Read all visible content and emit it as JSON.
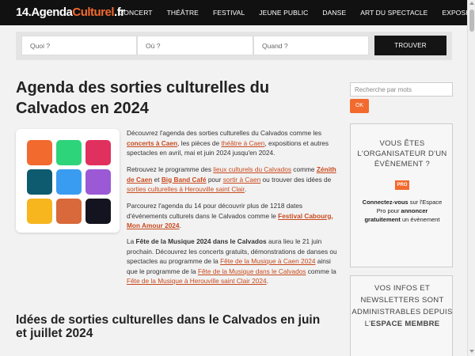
{
  "site": {
    "logo_prefix": "14.Agenda",
    "logo_accent": "Culturel",
    "logo_suffix": ".fr"
  },
  "nav": [
    {
      "label": "CONCERT"
    },
    {
      "label": "THÉÂTRE"
    },
    {
      "label": "FESTIVAL"
    },
    {
      "label": "JEUNE PUBLIC"
    },
    {
      "label": "DANSE"
    },
    {
      "label": "ART DU SPECTACLE"
    },
    {
      "label": "EXPOSITION"
    }
  ],
  "search": {
    "what_placeholder": "Quoi ?",
    "where_placeholder": "Où ?",
    "when_placeholder": "Quand ?",
    "button": "TROUVER"
  },
  "main": {
    "title": "Agenda des sorties culturelles du Calvados en 2024",
    "p1": {
      "a": "Découvrez l'agenda des sorties culturelles du Calvados comme les ",
      "l1": "concerts à Caen",
      "b": ", les pièces de ",
      "l2": "théâtre à Caen",
      "c": ", expositions et autres spectacles en avril, mai et juin 2024 jusqu'en 2024."
    },
    "p2": {
      "a": "Retrouvez le programme des ",
      "l1": "lieux culturels du Calvados",
      "b": " comme ",
      "l2": "Zénith de Caen",
      "c": " et ",
      "l3": "Big Band Café",
      "d": " pour ",
      "l4": "sortir à Caen",
      "e": " ou trouver des idées de ",
      "l5": "sorties culturelles à Herouville saint Clair",
      "f": "."
    },
    "p3": {
      "a": "Parcourez l'agenda du 14 pour découvrir plus de 1218 dates d'événements culturels dans le Calvados comme le ",
      "l1": "Festival Cabourg, Mon Amour 2024",
      "b": "."
    },
    "p4": {
      "a": "La ",
      "bold1": "Fête de la Musique 2024 dans le Calvados",
      "b": " aura lieu le 21 juin prochain. Découvrez les concerts gratuits, démonstrations de danses ou spectacles au programme de la ",
      "l1": "Fête de la Musique à Caen 2024",
      "c": " ainsi que le programme de la ",
      "l2": "Fête de la Musique dans le Calvados",
      "d": " comme la ",
      "l3": "Fête de la Musique à Herouville saint Clair 2024",
      "e": "."
    },
    "subtitle": "Idées de sorties culturelles dans le Calvados en juin et juillet 2024"
  },
  "icon_tiles": [
    "#f26a2e",
    "#2ed47a",
    "#e0305e",
    "#0e5a6e",
    "#3a9cf0",
    "#9b59d6",
    "#f7b51e",
    "#d9683a",
    "#141420"
  ],
  "sidebar": {
    "search_placeholder": "Recherche par mots",
    "ok_label": "OK",
    "card1_title": "VOUS ÊTES L'ORGANISATEUR D'UN ÉVÈNEMENT ?",
    "pro_badge": "PRO",
    "card1_bold1": "Connectez-vous",
    "card1_t1": " sur l'Espace Pro pour ",
    "card1_bold2": "annoncer gratuitement",
    "card1_t2": " un évènement",
    "card2_title_a": "VOS INFOS ET NEWSLETTERS SONT ADMINISTRABLES DEPUIS L'",
    "card2_title_b": "ESPACE MEMBRE"
  }
}
